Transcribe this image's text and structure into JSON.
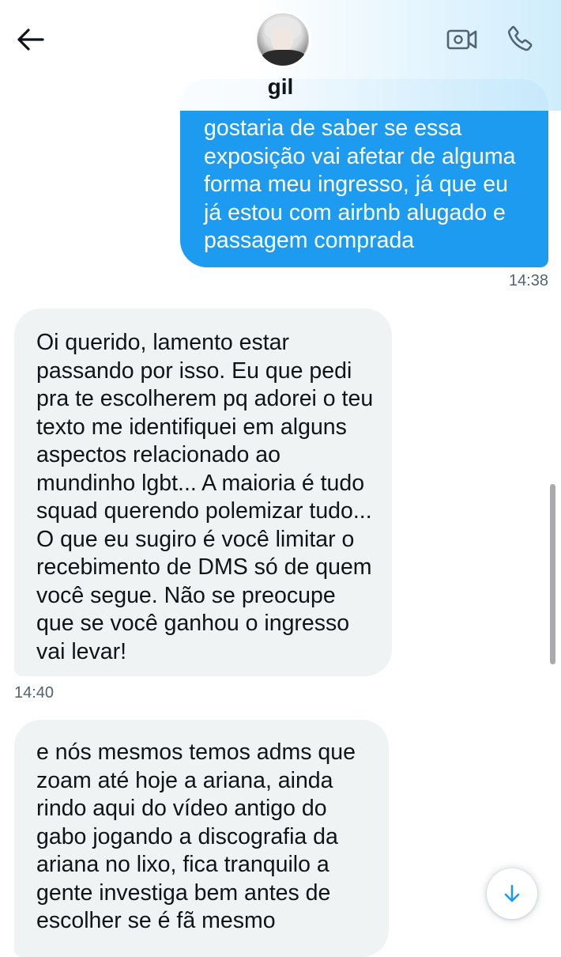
{
  "header": {
    "name": "gil",
    "back_icon": "arrow-left-icon",
    "video_icon": "video-camera-icon",
    "phone_icon": "phone-icon"
  },
  "messages": [
    {
      "direction": "sent",
      "text": "gostaria de saber se essa exposição vai afetar de alguma forma meu ingresso, já que eu já estou com airbnb alugado e passagem comprada",
      "time": "14:38"
    },
    {
      "direction": "received",
      "text": "Oi querido, lamento estar passando por isso. Eu que pedi pra te escolherem pq adorei o teu texto me identifiquei em alguns aspectos relacionado ao mundinho lgbt... A maioria é tudo squad querendo polemizar tudo... O que eu sugiro é você limitar o recebimento de DMS só de quem você segue. Não se preocupe que se você ganhou o ingresso vai levar!",
      "time": "14:40"
    },
    {
      "direction": "received",
      "text": "e nós mesmos temos adms que zoam até hoje a ariana, ainda rindo aqui do vídeo antigo do gabo jogando a discografia da ariana no lixo, fica tranquilo a gente investiga bem antes de escolher se é fã mesmo"
    }
  ],
  "colors": {
    "sent_bubble": "#1d9bf0",
    "received_bubble": "#eff3f4",
    "text_primary": "#0f1419",
    "text_secondary": "#536471",
    "accent": "#1d9bf0"
  },
  "scroll_down_icon": "arrow-down-icon"
}
